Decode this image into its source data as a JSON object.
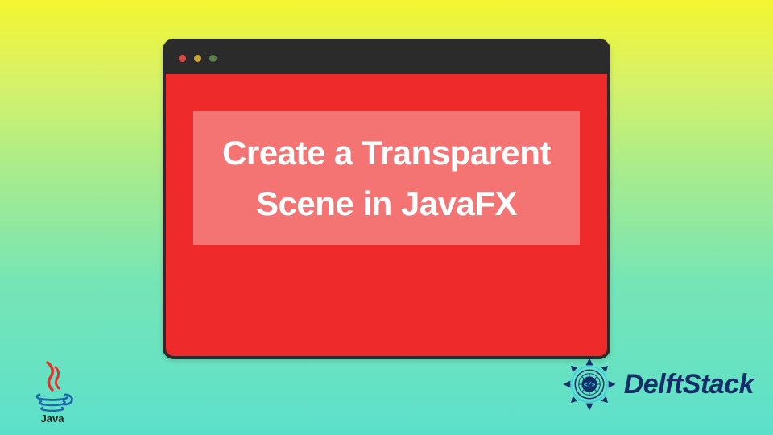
{
  "window": {
    "titlebar": {
      "dots": [
        "red",
        "yellow",
        "green"
      ]
    },
    "content": {
      "heading": "Create a Transparent Scene in JavaFX"
    }
  },
  "logos": {
    "java_label": "Java",
    "delft_label": "DelftStack"
  },
  "colors": {
    "window_bg": "#ee2a2a",
    "window_border": "#2b2b2b",
    "text": "#ffffff",
    "delft_primary": "#152e6a",
    "java_red": "#e8302b",
    "java_blue": "#1a6aa8"
  }
}
